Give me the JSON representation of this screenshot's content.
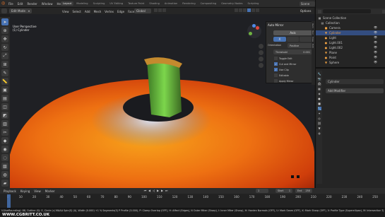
{
  "topbar": {
    "menus": [
      "File",
      "Edit",
      "Render",
      "Window",
      "Help"
    ],
    "workspace_tabs": [
      "Layout",
      "Modeling",
      "Sculpting",
      "UV Editing",
      "Texture Paint",
      "Shading",
      "Animation",
      "Rendering",
      "Compositing",
      "Geometry Nodes",
      "Scripting"
    ],
    "scene_label": "Scene",
    "view_layer_label": "View Layer"
  },
  "viewport_header": {
    "mode": "Edit Mode",
    "menus": [
      "View",
      "Select",
      "Add",
      "Mesh",
      "Vertex",
      "Edge",
      "Face",
      "UV"
    ],
    "orientation": "Global",
    "options_label": "Options",
    "select_label": "Select Box"
  },
  "viewport_info": {
    "line1": "User Perspective",
    "line2": "(1) Cylinder"
  },
  "npanel": {
    "title": "Auto Mirror",
    "axis_label": "Axis",
    "axis_value": "X",
    "direction_label": "Orientation",
    "direction_value": "Positive",
    "threshold_label": "Threshold",
    "threshold_value": "0.001",
    "checkboxes": [
      "Toggle Edit",
      "Cut and Mirror",
      "Use Clip",
      "Editable",
      "Apply Mirror"
    ],
    "tabs": [
      "Item",
      "Tool",
      "View",
      "Edit"
    ]
  },
  "outliner": {
    "search_placeholder": "",
    "scene_collection": "Scene Collection",
    "collection": "Collection",
    "items": [
      "Camera",
      "Cylinder",
      "Light",
      "Light.001",
      "Light.002",
      "Plane",
      "Point",
      "Sphere"
    ]
  },
  "properties": {
    "object_name": "Cylinder",
    "add_modifier": "Add Modifier"
  },
  "timeline": {
    "menus": [
      "Playback",
      "Keying",
      "View",
      "Marker"
    ],
    "current_frame": "1",
    "start_label": "Start",
    "start_value": "1",
    "end_label": "End",
    "end_value": "250",
    "ticks": [
      "0",
      "10",
      "20",
      "30",
      "40",
      "50",
      "60",
      "70",
      "80",
      "90",
      "100",
      "110",
      "120",
      "130",
      "140",
      "150",
      "160",
      "170",
      "180",
      "190",
      "200",
      "210",
      "220",
      "230",
      "240",
      "250"
    ]
  },
  "status": {
    "text": "U(UseRounding): 88, Outline (S): E, Circle (c) MAAA Spin(S) (A), Width (0.000) +1 % Segments(S)  P Profile (3.000), P: Clamp Overlap (OFF), H: Affect (Edges), N Outer Miter (Sharp), I: Inner Miter (Sharp), H: Harden Normals (OFF), U: Mark Seam (OFF), K: Mark Sharp (OFF), V: Profile Type (Superellipse), M: Intersection Type (Grid Fill)",
    "watermark": "WWW.CGBRITT.CO.UK"
  },
  "colors": {
    "accent": "#4772b3",
    "selected_object": "#f0a040",
    "stalk": "#5fbf3f",
    "fruit_outer": "#c83a0b",
    "fruit_inner": "#f28a14"
  }
}
